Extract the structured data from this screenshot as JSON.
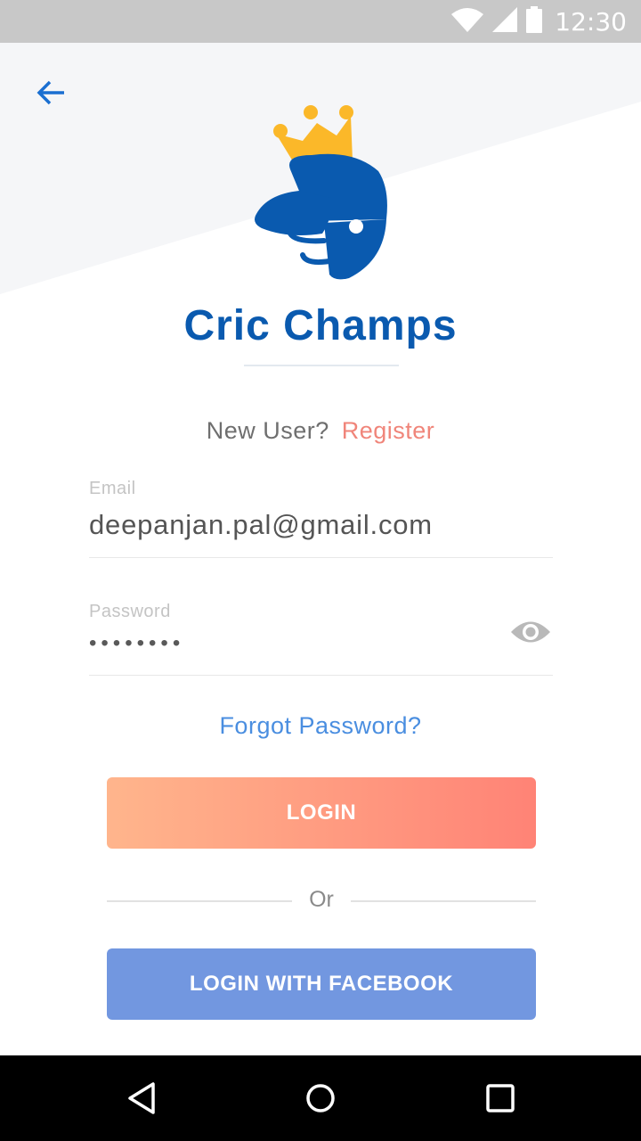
{
  "status_bar": {
    "time": "12:30",
    "icons": [
      "wifi-icon",
      "cellular-signal-icon",
      "battery-icon"
    ]
  },
  "header": {
    "back_icon": "arrow-left-icon",
    "logo_icon": "helmet-crown-logo"
  },
  "app": {
    "title": "Cric Champs"
  },
  "register": {
    "prompt": "New User?",
    "link": "Register"
  },
  "form": {
    "email": {
      "label": "Email",
      "value": "deepanjan.pal@gmail.com"
    },
    "password": {
      "label": "Password",
      "value": "••••••••",
      "toggle_icon": "eye-icon"
    },
    "forgot": "Forgot Password?",
    "login": "LOGIN",
    "separator": "Or",
    "facebook": "LOGIN WITH FACEBOOK"
  },
  "nav_bar": {
    "buttons": [
      "back-triangle-icon",
      "home-circle-icon",
      "recents-square-icon"
    ]
  },
  "colors": {
    "brand_blue": "#0a5aaf",
    "crown_yellow": "#fbb829",
    "register_coral": "#f0857a",
    "link_blue": "#4a8ee0",
    "login_gradient_start": "#ffb58c",
    "login_gradient_end": "#ff8376",
    "facebook_blue": "#7297e0"
  }
}
